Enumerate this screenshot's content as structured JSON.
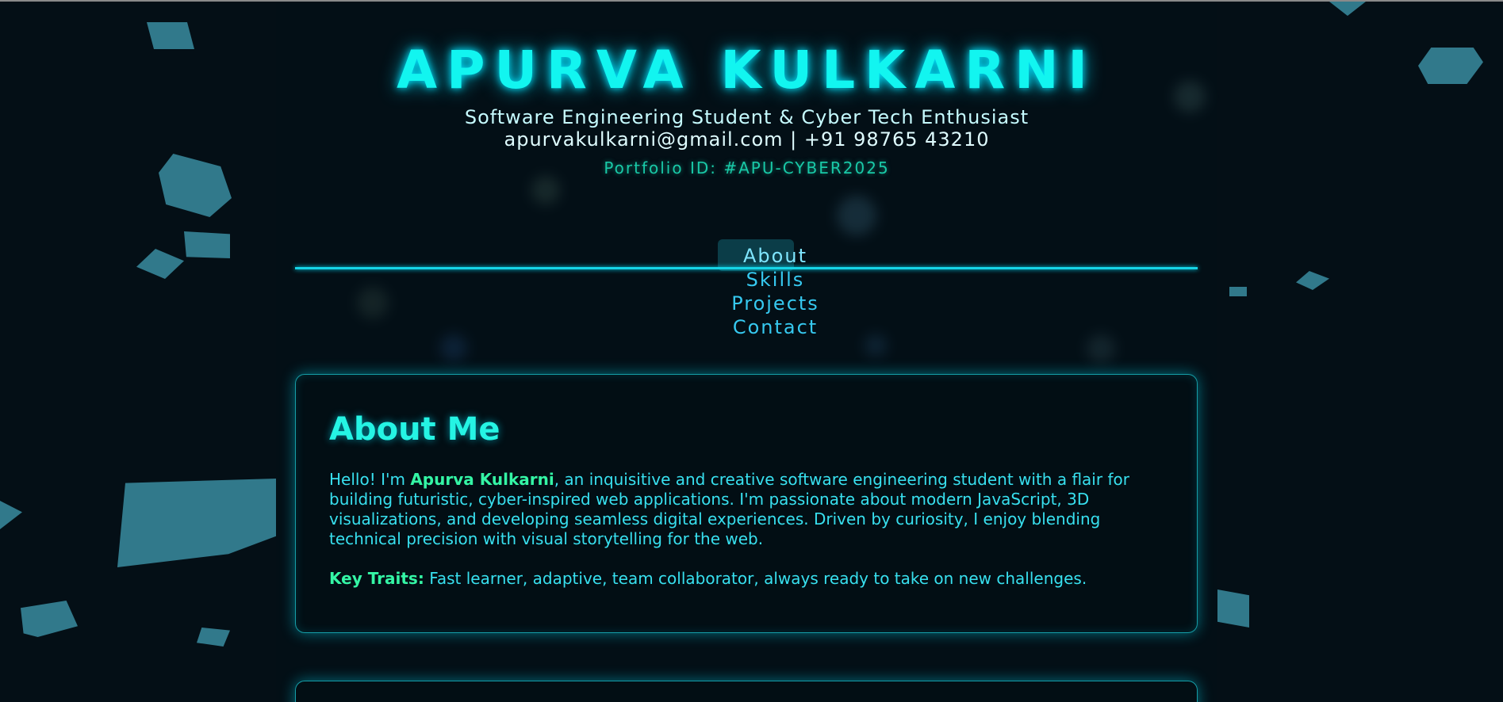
{
  "header": {
    "name": "APURVA KULKARNI",
    "subtitle": "Software Engineering Student & Cyber Tech Enthusiast",
    "contact": "apurvakulkarni@gmail.com | +91 98765 43210",
    "portfolio_id": "Portfolio ID: #APU-CYBER2025"
  },
  "nav": {
    "items": [
      {
        "label": "About"
      },
      {
        "label": "Skills"
      },
      {
        "label": "Projects"
      },
      {
        "label": "Contact"
      }
    ],
    "active": "About"
  },
  "about": {
    "title": "About Me",
    "intro_prefix": "Hello! I'm ",
    "intro_name": "Apurva Kulkarni",
    "intro_rest": ", an inquisitive and creative software engineering student with a flair for building futuristic, cyber-inspired web applications. I'm passionate about modern JavaScript, 3D visualizations, and developing seamless digital experiences. Driven by curiosity, I enjoy blending technical precision with visual storytelling for the web.",
    "traits_label": "Key Traits:",
    "traits_text": " Fast learner, adaptive, team collaborator, always ready to take on new challenges."
  },
  "colors": {
    "accent": "#12f5f0",
    "highlight": "#34f5a5",
    "background": "#040f16"
  }
}
